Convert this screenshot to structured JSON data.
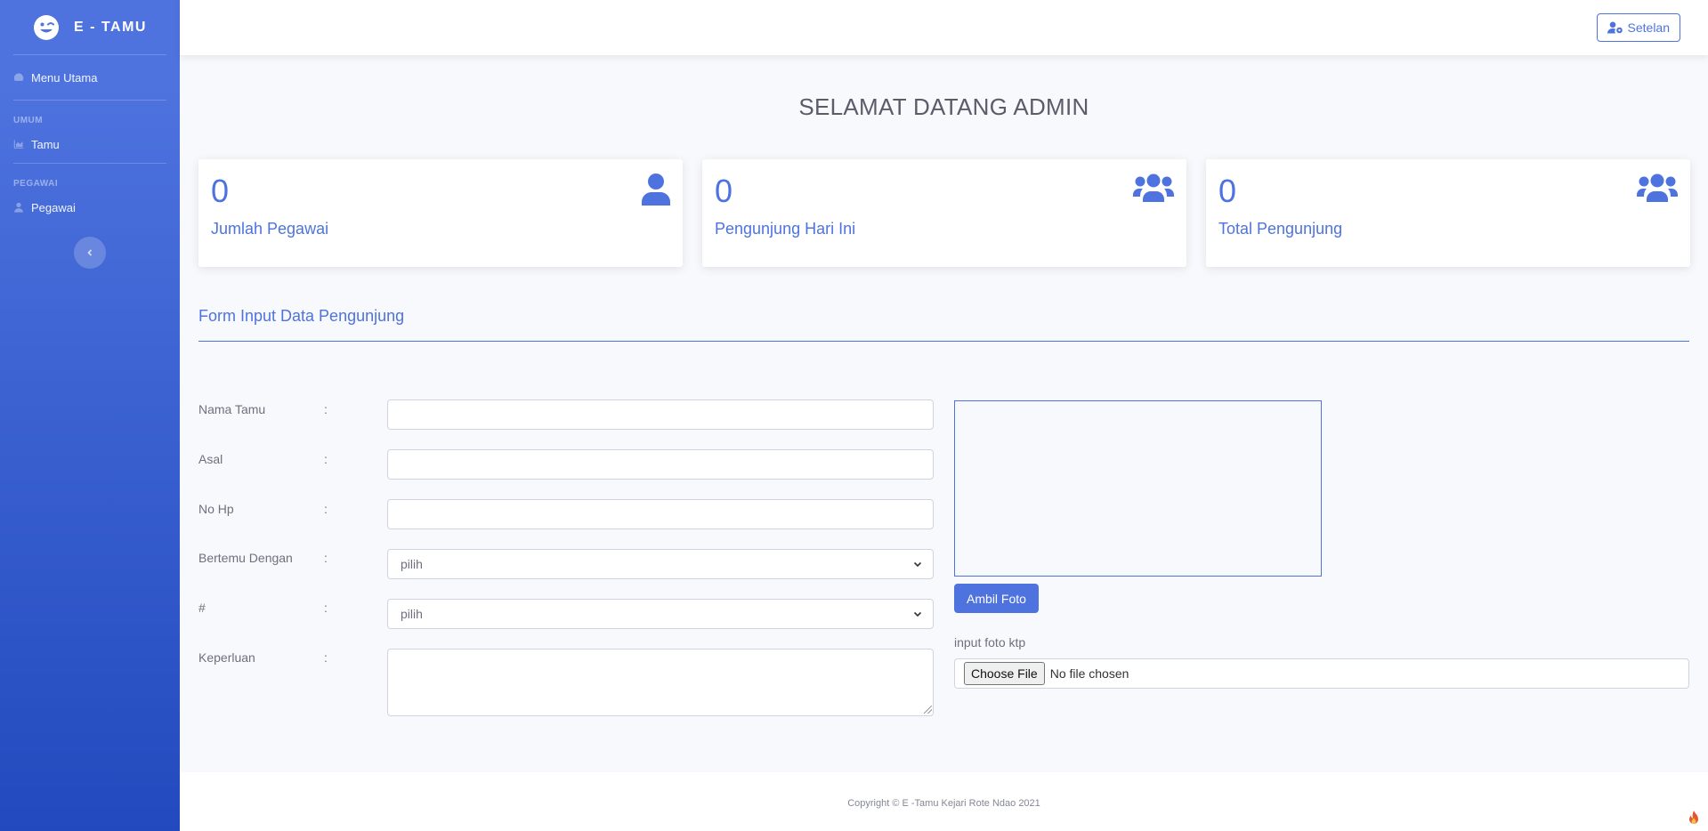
{
  "brand": {
    "name": "E - TAMU",
    "icon": "grin-wink-icon"
  },
  "sidebar": {
    "menu_utama": {
      "label": "Menu Utama",
      "icon": "tachometer-icon"
    },
    "heading_umum": "UMUM",
    "tamu": {
      "label": "Tamu",
      "icon": "chart-area-icon"
    },
    "heading_pegawai": "PEGAWAI",
    "pegawai": {
      "label": "Pegawai",
      "icon": "user-icon"
    },
    "toggle_icon": "chevron-left-icon"
  },
  "topbar": {
    "settings_label": "Setelan",
    "settings_icon": "user-cog-icon"
  },
  "page_title": "SELAMAT DATANG ADMIN",
  "cards": [
    {
      "value": "0",
      "label": "Jumlah Pegawai",
      "icon": "user-icon"
    },
    {
      "value": "0",
      "label": "Pengunjung Hari Ini",
      "icon": "users-icon"
    },
    {
      "value": "0",
      "label": "Total Pengunjung",
      "icon": "users-icon"
    }
  ],
  "form": {
    "title": "Form Input Data Pengunjung",
    "colon": ":",
    "fields": {
      "nama_tamu": {
        "label": "Nama Tamu",
        "value": ""
      },
      "asal": {
        "label": "Asal",
        "value": ""
      },
      "no_hp": {
        "label": "No Hp",
        "value": ""
      },
      "bertemu_dengan": {
        "label": "Bertemu Dengan",
        "selected": "pilih"
      },
      "hash": {
        "label": "#",
        "selected": "pilih"
      },
      "keperluan": {
        "label": "Keperluan",
        "value": ""
      }
    },
    "ambil_foto_label": "Ambil Foto",
    "ktp_label": "input foto ktp",
    "choose_file_label": "Choose File",
    "no_file_text": "No file chosen"
  },
  "footer": {
    "copyright": "Copyright © E -Tamu Kejari Rote Ndao 2021"
  },
  "colors": {
    "primary": "#4e73df",
    "sidebar_dark": "#224abe",
    "text_muted": "#858796"
  }
}
